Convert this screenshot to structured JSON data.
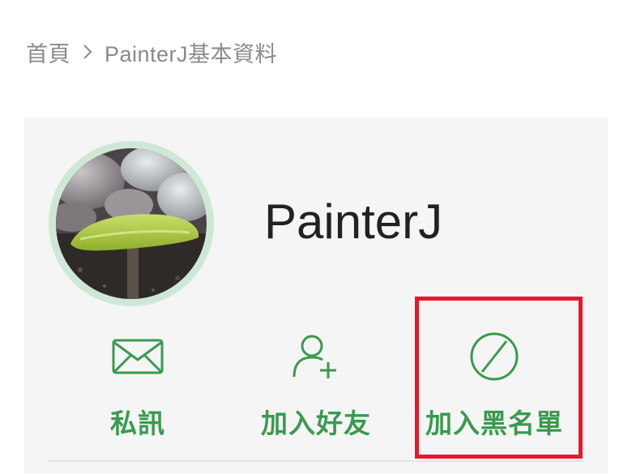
{
  "breadcrumb": {
    "home": "首頁",
    "current": "PainterJ基本資料"
  },
  "profile": {
    "username": "PainterJ"
  },
  "actions": {
    "message_label": "私訊",
    "add_friend_label": "加入好友",
    "block_label": "加入黑名單"
  },
  "colors": {
    "accent": "#3a9a4f",
    "highlight": "#e8182c"
  }
}
